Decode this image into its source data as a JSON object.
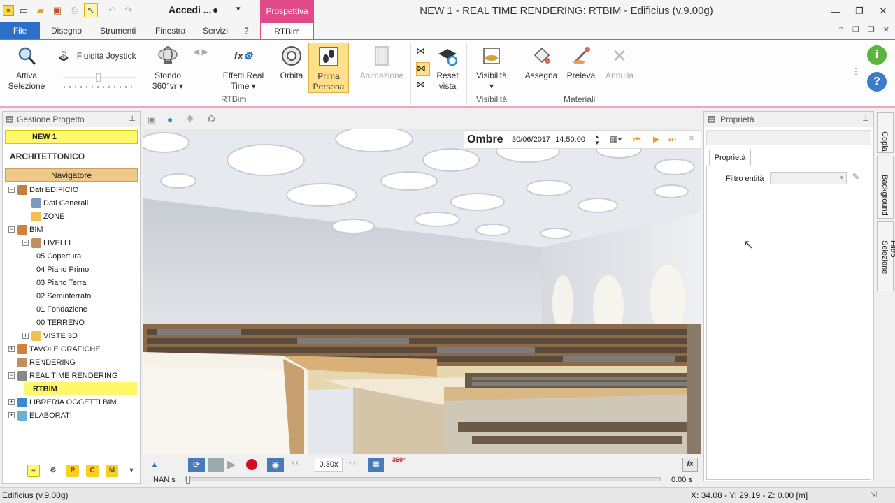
{
  "window": {
    "title": "NEW 1 -  REAL TIME RENDERING: RTBIM - Edificius (v.9.00g)",
    "context_tab": "Prospettiva",
    "account": "Accedi ..."
  },
  "tabs": [
    "File",
    "Disegno",
    "Strumenti",
    "Finestra",
    "Servizi",
    "?",
    "RTBim"
  ],
  "ribbon": {
    "attiva_selezione": "Attiva\nSelezione",
    "fluidita": "Fluidità Joystick",
    "sfondo": "Sfondo\n360°vr ▾",
    "effetti": "Effetti Real\nTime ▾",
    "orbita": "Orbita",
    "prima_persona": "Prima\nPersona",
    "animazione": "Animazione",
    "reset_vista": "Reset\nvista",
    "visibilita": "Visibilità\n▾",
    "assegna": "Assegna",
    "preleva": "Preleva",
    "annulla": "Annulla",
    "groups": {
      "rtbim": "RTBim",
      "visibilita": "Visibilità",
      "materiali": "Materiali"
    }
  },
  "left_panel": {
    "title": "Gestione Progetto",
    "project": "NEW 1",
    "section": "ARCHITETTONICO",
    "navigator": "Navigatore",
    "tree": [
      {
        "label": "Dati EDIFICIO",
        "level": 0,
        "exp": "−"
      },
      {
        "label": "Dati Generali",
        "level": 1,
        "exp": ""
      },
      {
        "label": "ZONE",
        "level": 1,
        "exp": ""
      },
      {
        "label": "BIM",
        "level": 0,
        "exp": "−"
      },
      {
        "label": "LIVELLI",
        "level": 1,
        "exp": "−"
      },
      {
        "label": "05 Copertura",
        "level": 2,
        "exp": ""
      },
      {
        "label": "04 Piano Primo",
        "level": 2,
        "exp": ""
      },
      {
        "label": "03 Piano Terra",
        "level": 2,
        "exp": ""
      },
      {
        "label": "02 Seminterrato",
        "level": 2,
        "exp": ""
      },
      {
        "label": "01 Fondazione",
        "level": 2,
        "exp": ""
      },
      {
        "label": "00 TERRENO",
        "level": 2,
        "exp": ""
      },
      {
        "label": "VISTE 3D",
        "level": 1,
        "exp": "+"
      },
      {
        "label": "TAVOLE GRAFICHE",
        "level": 0,
        "exp": "+"
      },
      {
        "label": "RENDERING",
        "level": 0,
        "exp": ""
      },
      {
        "label": "REAL TIME RENDERING",
        "level": 0,
        "exp": "−"
      },
      {
        "label": "RTBIM",
        "level": 1,
        "exp": "",
        "selected": true
      },
      {
        "label": "LIBRERIA OGGETTI BIM",
        "level": 0,
        "exp": "+"
      },
      {
        "label": "ELABORATI",
        "level": 0,
        "exp": "+"
      }
    ]
  },
  "viewport": {
    "ombre_label": "Ombre",
    "date": "30/06/2017",
    "time": "14:50:00",
    "speed": "0.30x",
    "time_start": "NAN s",
    "time_end": "0.00 s"
  },
  "right_panel": {
    "title": "Proprietà",
    "tab": "Proprietà",
    "filter_label": "Filtro entità",
    "side_tabs": [
      "Copia",
      "Background",
      "Filtro Selezione"
    ]
  },
  "status": {
    "left": "Edificius (v.9.00g)",
    "coords": "X: 34.08 - Y: 29.19 - Z: 0.00 [m]"
  },
  "colors": {
    "accent": "#e24a8a",
    "file_tab": "#2b6fc9",
    "highlight": "#fff86b",
    "navigator": "#f0c888"
  }
}
